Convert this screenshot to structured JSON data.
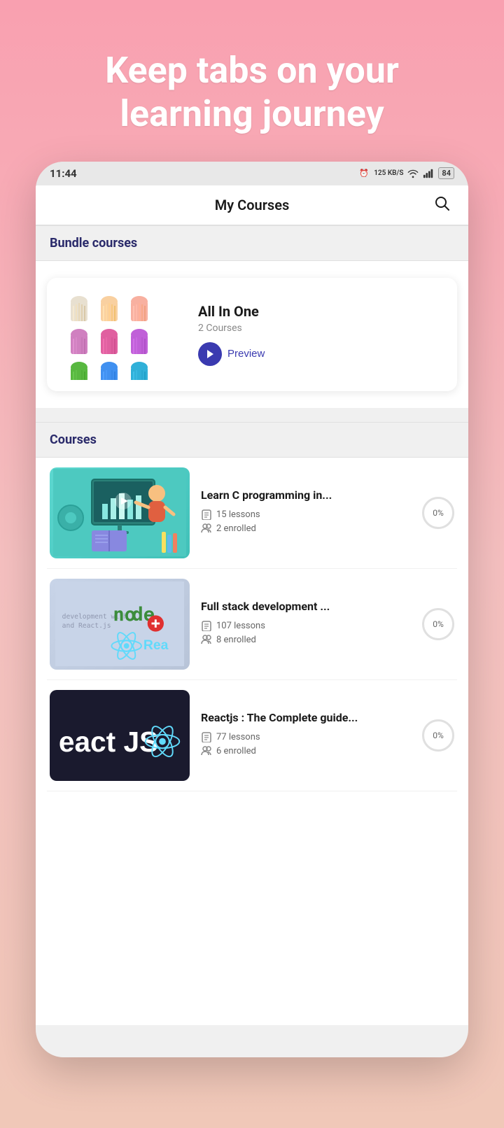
{
  "hero": {
    "line1": "Keep tabs on your",
    "line2": "learning journey"
  },
  "statusBar": {
    "time": "11:44",
    "data": "125 KB/S",
    "battery": "84"
  },
  "header": {
    "title": "My Courses",
    "searchLabel": "search"
  },
  "bundleSection": {
    "heading": "Bundle courses",
    "card": {
      "title": "All In One",
      "subtitle": "2 Courses",
      "previewLabel": "Preview"
    }
  },
  "coursesSection": {
    "heading": "Courses",
    "courses": [
      {
        "title": "Learn C programming in...",
        "lessons": "15 lessons",
        "enrolled": "2 enrolled",
        "progress": "0%"
      },
      {
        "title": "Full stack development ...",
        "lessons": "107 lessons",
        "enrolled": "8 enrolled",
        "progress": "0%"
      },
      {
        "title": "Reactjs : The Complete guide...",
        "lessons": "77 lessons",
        "enrolled": "6 enrolled",
        "progress": "0%"
      }
    ]
  },
  "colors": {
    "brand": "#3a3ab0",
    "sectionHeader": "#2a2a6a",
    "pink": "#f9a0b0"
  }
}
